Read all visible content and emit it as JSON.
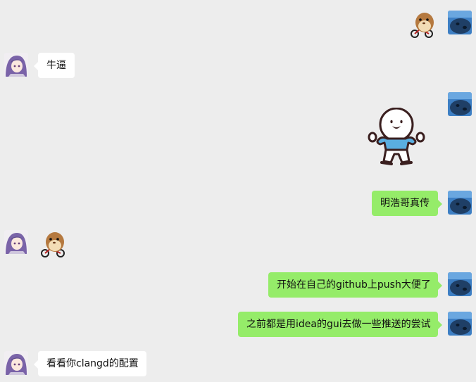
{
  "conversation": {
    "messages": [
      {
        "side": "right",
        "type": "sticker",
        "sticker": "hamster-on-bike-sticker"
      },
      {
        "side": "left",
        "type": "text",
        "text": "牛逼"
      },
      {
        "side": "right",
        "type": "sticker",
        "sticker": "cartoon-dancing-man-sticker"
      },
      {
        "side": "right",
        "type": "text",
        "text": "明浩哥真传"
      },
      {
        "side": "left",
        "type": "sticker",
        "sticker": "hamster-on-bike-sticker"
      },
      {
        "side": "right",
        "type": "text",
        "text": "开始在自己的github上push大便了"
      },
      {
        "side": "right",
        "type": "text",
        "text": "之前都是用idea的gui去做一些推送的尝试"
      },
      {
        "side": "left",
        "type": "text",
        "text": "看看你clangd的配置"
      }
    ]
  },
  "colors": {
    "background": "#ededed",
    "sent_bubble": "#95ec69",
    "received_bubble": "#ffffff"
  }
}
